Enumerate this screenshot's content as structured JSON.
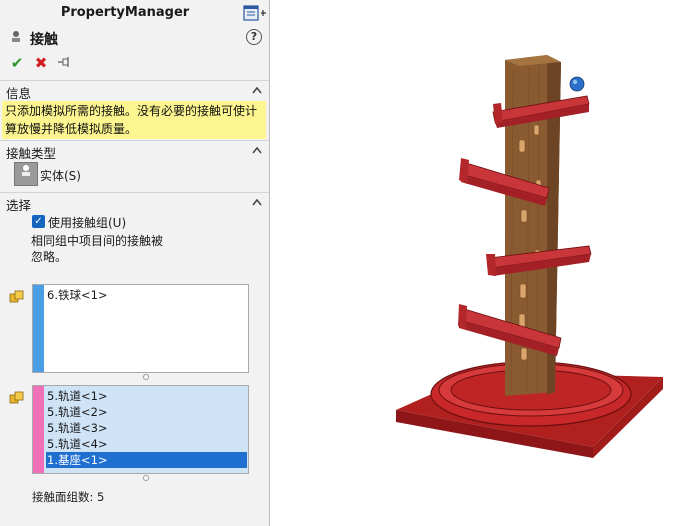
{
  "property_manager": {
    "title": "PropertyManager",
    "feature_name": "接触",
    "help_glyph": "?",
    "ok_icon": "checkmark-icon",
    "cancel_icon": "x-icon",
    "pin_icon": "pushpin-icon"
  },
  "sections": {
    "info": {
      "label": "信息",
      "text": "只添加模拟所需的接触。没有必要的接触可使计算放慢并降低模拟质量。"
    },
    "contact_type": {
      "label": "接触类型",
      "option_label": "实体(S)"
    },
    "selection": {
      "label": "选择",
      "use_group_label": "使用接触组(U)",
      "use_group_checked": true,
      "note": "相同组中项目间的接触被忽略。",
      "group1": [
        "6.铁球<1>"
      ],
      "group2": [
        "5.轨道<1>",
        "5.轨道<2>",
        "5.轨道<3>",
        "5.轨道<4>",
        "1.基座<1>"
      ],
      "group2_selected_index": 4,
      "count_label": "接触面组数:",
      "count_value": "5"
    }
  },
  "colors": {
    "group1_bar": "#4a9ee6",
    "group2_bar": "#ef6fb8",
    "info_bg": "#fcf590",
    "selection_blue": "#1f6fd1",
    "wood": "#8a5a30",
    "red_part": "#c8282a",
    "ball": "#2a6fc9"
  }
}
